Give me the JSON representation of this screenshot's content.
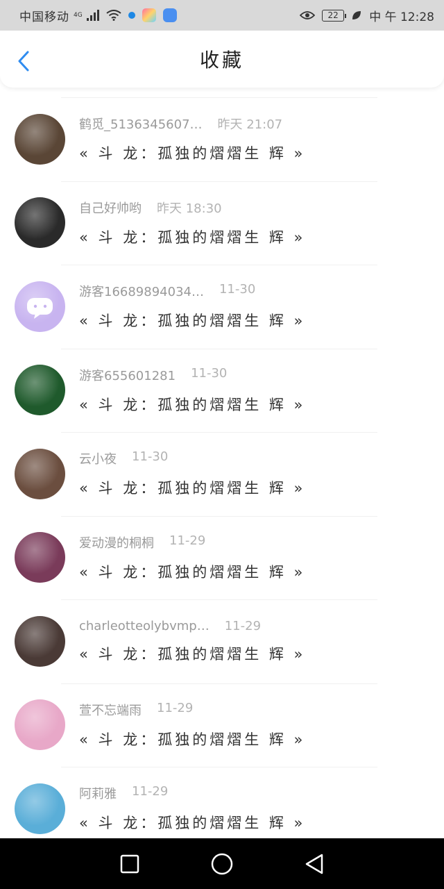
{
  "status_bar": {
    "carrier": "中国移动",
    "network": "4G",
    "time": "中 午 12:28",
    "battery": "22"
  },
  "header": {
    "title": "收藏"
  },
  "favorites": [
    {
      "name": "鹤觅_5136345607…",
      "time": "昨天 21:07",
      "message": "« 斗 龙：孤独的熠熠生 辉 »",
      "avatar_color": "#5a4636"
    },
    {
      "name": "自己好帅哟",
      "time": "昨天 18:30",
      "message": "« 斗 龙：孤独的熠熠生 辉 »",
      "avatar_color": "#2a2a2a"
    },
    {
      "name": "游客16689894034…",
      "time": "11-30",
      "message": "« 斗 龙：孤独的熠熠生 辉 »",
      "avatar_color": "#c8b4f0"
    },
    {
      "name": "游客655601281",
      "time": "11-30",
      "message": "« 斗 龙：孤独的熠熠生 辉 »",
      "avatar_color": "#1f5a2c"
    },
    {
      "name": "云小夜",
      "time": "11-30",
      "message": "« 斗 龙：孤独的熠熠生 辉 »",
      "avatar_color": "#6b4e3f"
    },
    {
      "name": "爱动漫的桐桐",
      "time": "11-29",
      "message": "« 斗 龙：孤独的熠熠生 辉 »",
      "avatar_color": "#7a3b5a"
    },
    {
      "name": "charleotteolybvmp…",
      "time": "11-29",
      "message": "« 斗 龙：孤独的熠熠生 辉 »",
      "avatar_color": "#4a3a36"
    },
    {
      "name": "萱不忘端雨",
      "time": "11-29",
      "message": "« 斗 龙：孤独的熠熠生 辉 »",
      "avatar_color": "#e8a8c8"
    },
    {
      "name": "阿莉雅",
      "time": "11-29",
      "message": "« 斗 龙：孤独的熠熠生 辉 »",
      "avatar_color": "#5aaed8"
    }
  ],
  "colors": {
    "accent": "#2f8cf0",
    "status_bar_bg": "#d9d9d9",
    "nav_bar_bg": "#000000"
  }
}
